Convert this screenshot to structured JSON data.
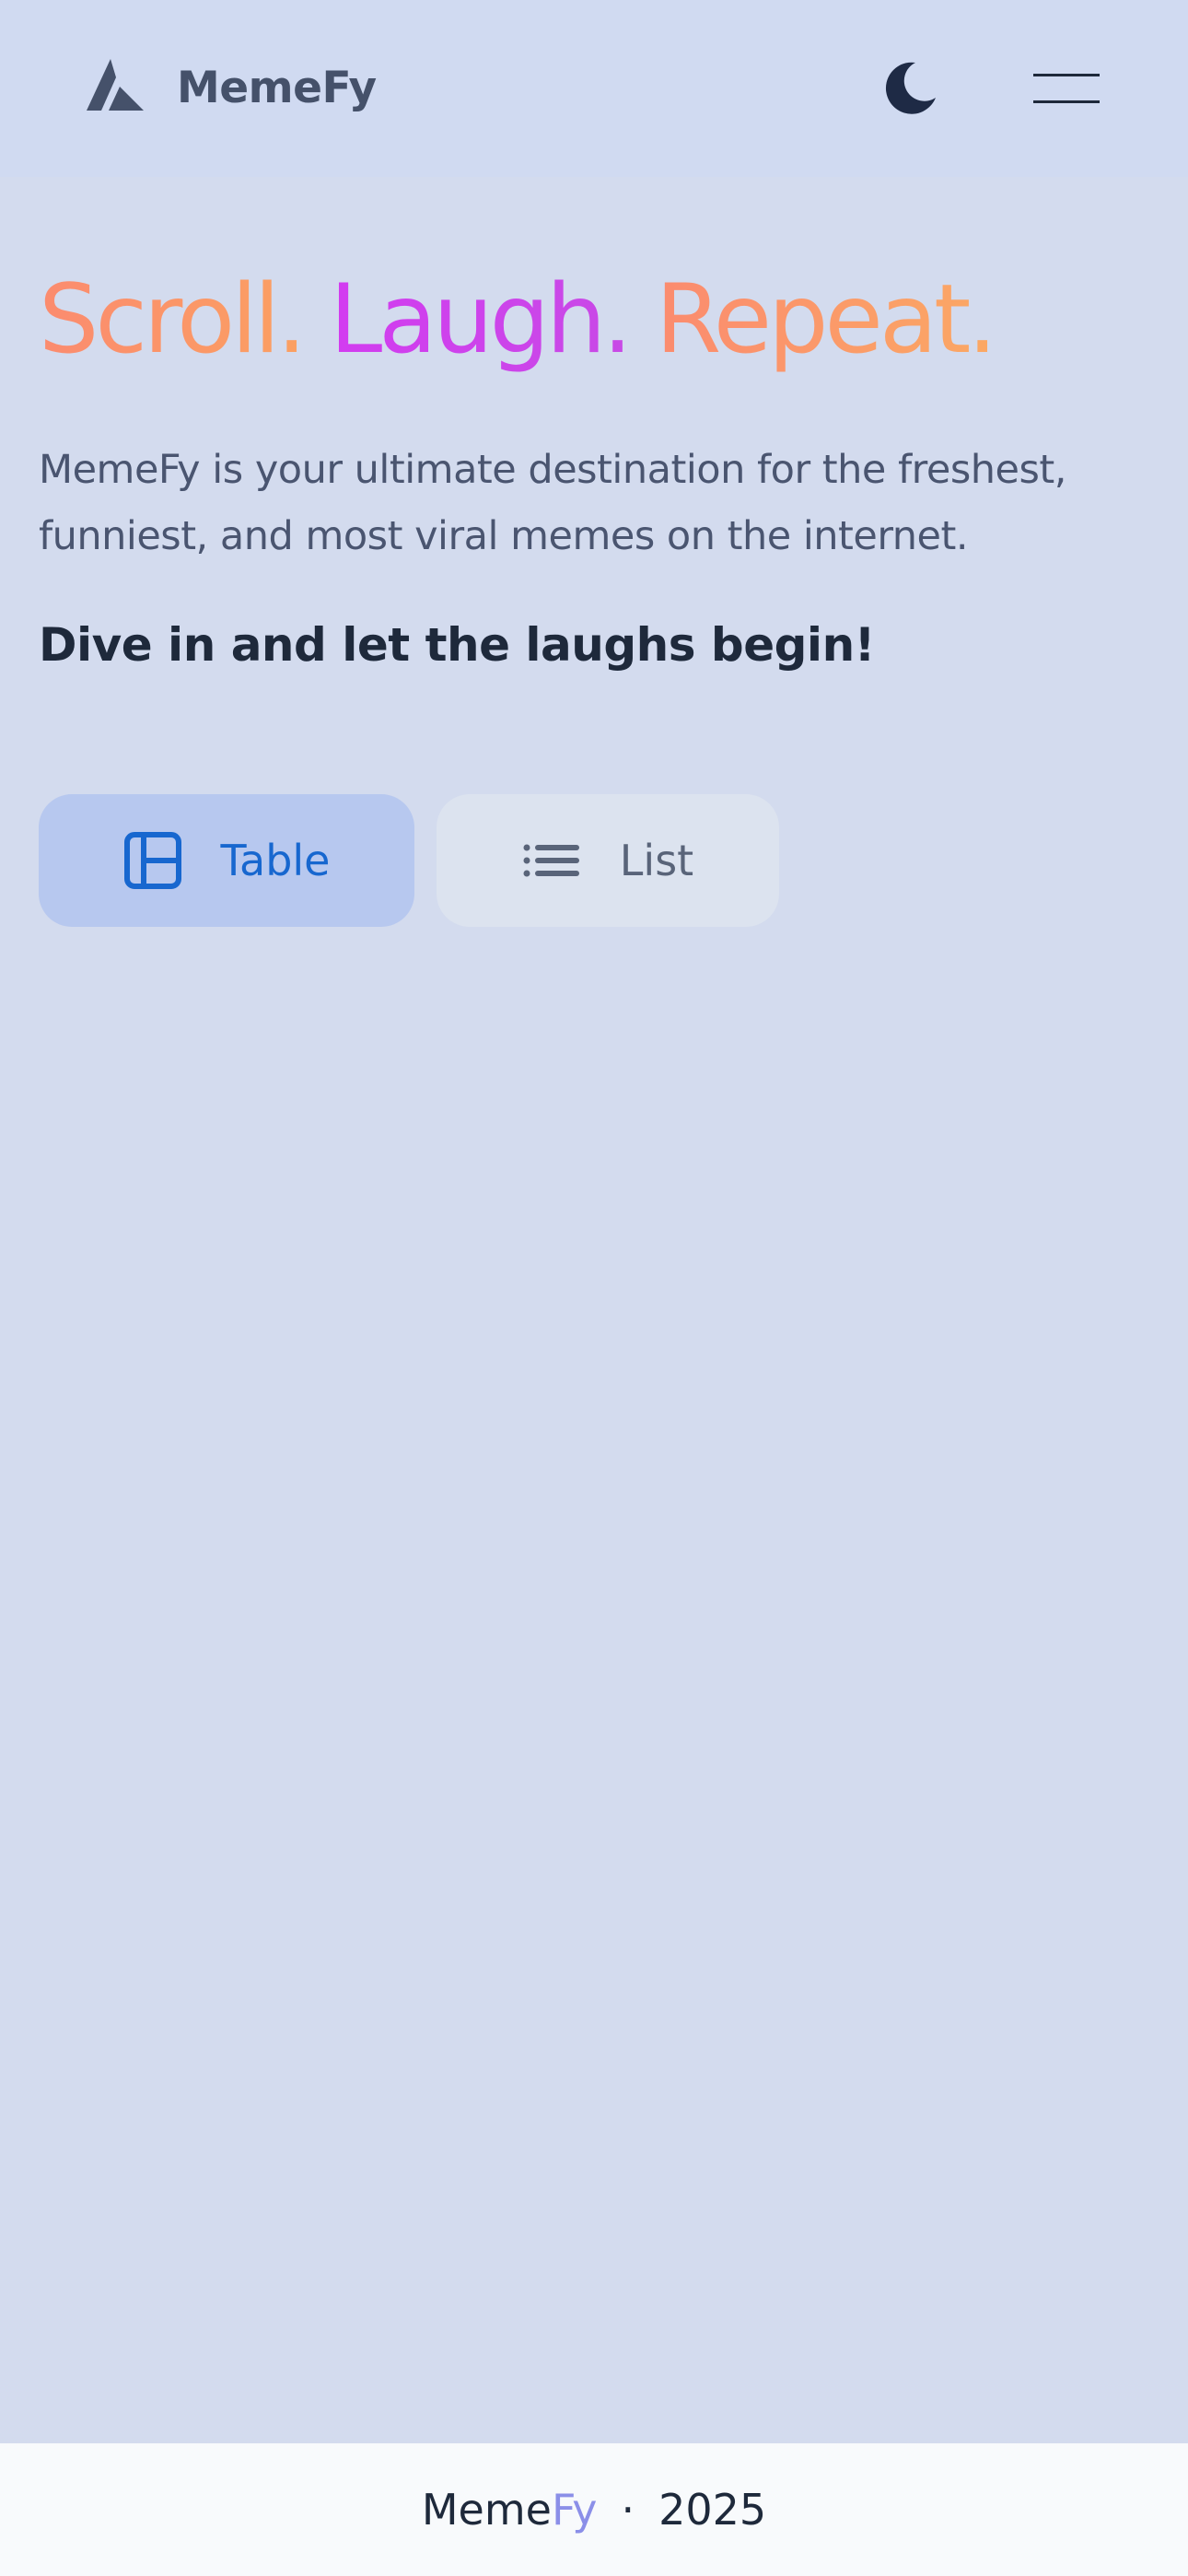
{
  "header": {
    "brand": "MemeFy",
    "logo_icon": "triangle-logo-icon",
    "theme_toggle_icon": "moon-icon",
    "menu_icon": "hamburger-menu-icon"
  },
  "hero": {
    "title_parts": [
      "Scroll.",
      "Laugh.",
      "Repeat."
    ],
    "description": "MemeFy is your ultimate destination for the freshest, funniest, and most viral memes on the internet.",
    "tagline": "Dive in and let the laughs begin!"
  },
  "view_toggle": {
    "selected": "Table",
    "options": [
      {
        "label": "Table",
        "icon": "table-layout-icon"
      },
      {
        "label": "List",
        "icon": "list-icon"
      }
    ]
  },
  "footer": {
    "brand_part1": "Meme",
    "brand_part2": "Fy",
    "separator": "·",
    "year": "2025"
  },
  "colors": {
    "background": "#d3dbee",
    "header_background": "#d0daf1",
    "gradient_orange": "#fb8b6f",
    "gradient_magenta": "#d23cf0",
    "selected_button": "#b7c8ef",
    "selected_text": "#1767cf",
    "footer_accent": "#8b8fe8"
  }
}
